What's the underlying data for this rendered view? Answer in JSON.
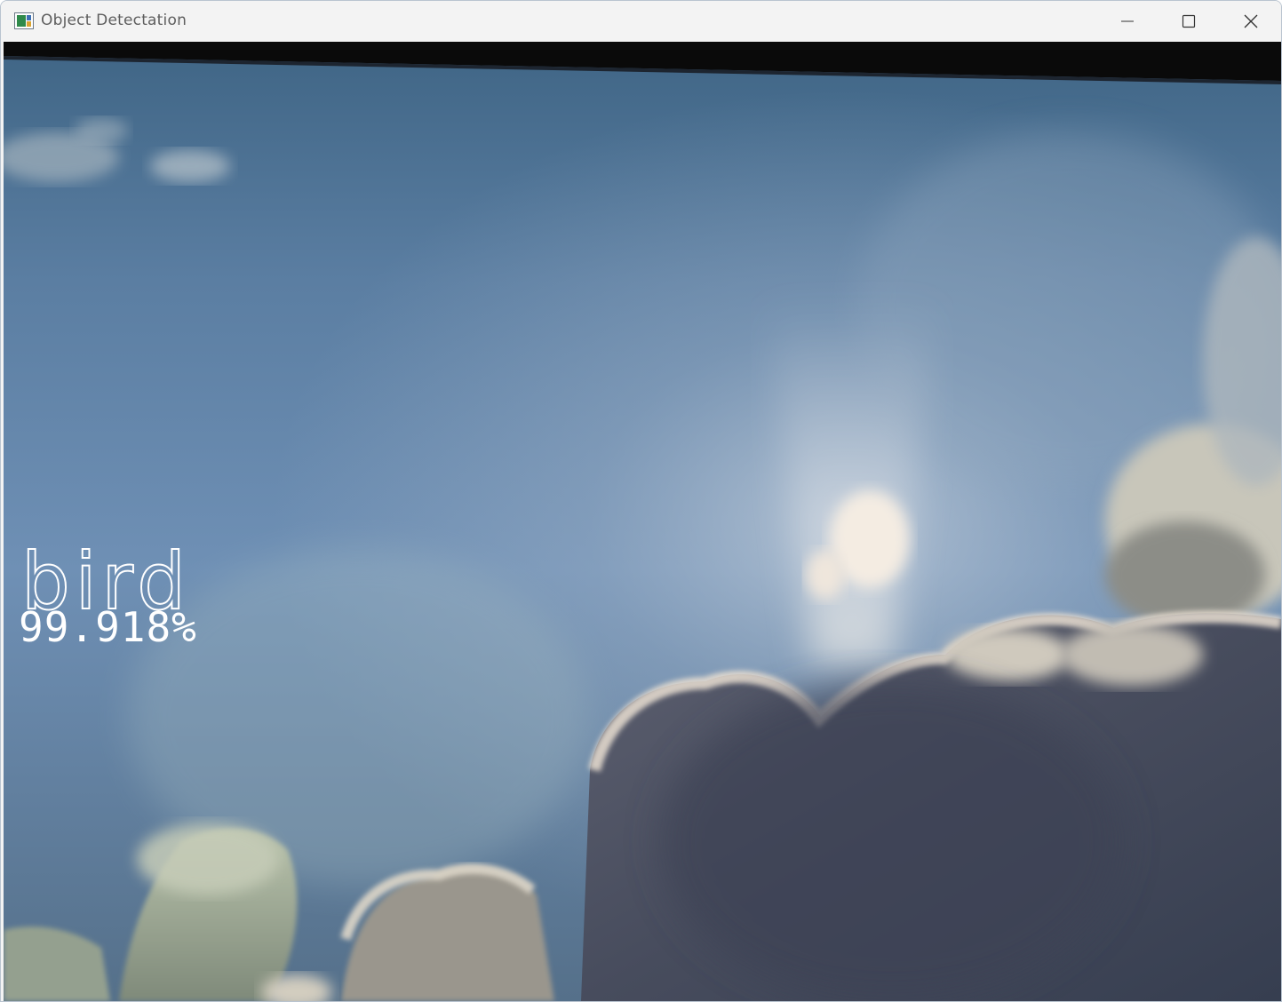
{
  "window": {
    "title": "Object Detectation",
    "icon": "window-app-icon",
    "controls": {
      "minimize": "minimize-icon",
      "maximize": "maximize-icon",
      "close": "close-icon"
    }
  },
  "detection": {
    "label": "bird",
    "confidence": "99.918%"
  },
  "colors": {
    "titlebar_bg": "#f3f3f3",
    "title_text": "#5e5e5e",
    "overlay_text": "#ffffff",
    "sky_light": "#8fa7c4",
    "sky_dark": "#3d6585",
    "cloud_dark": "#3d4658"
  }
}
